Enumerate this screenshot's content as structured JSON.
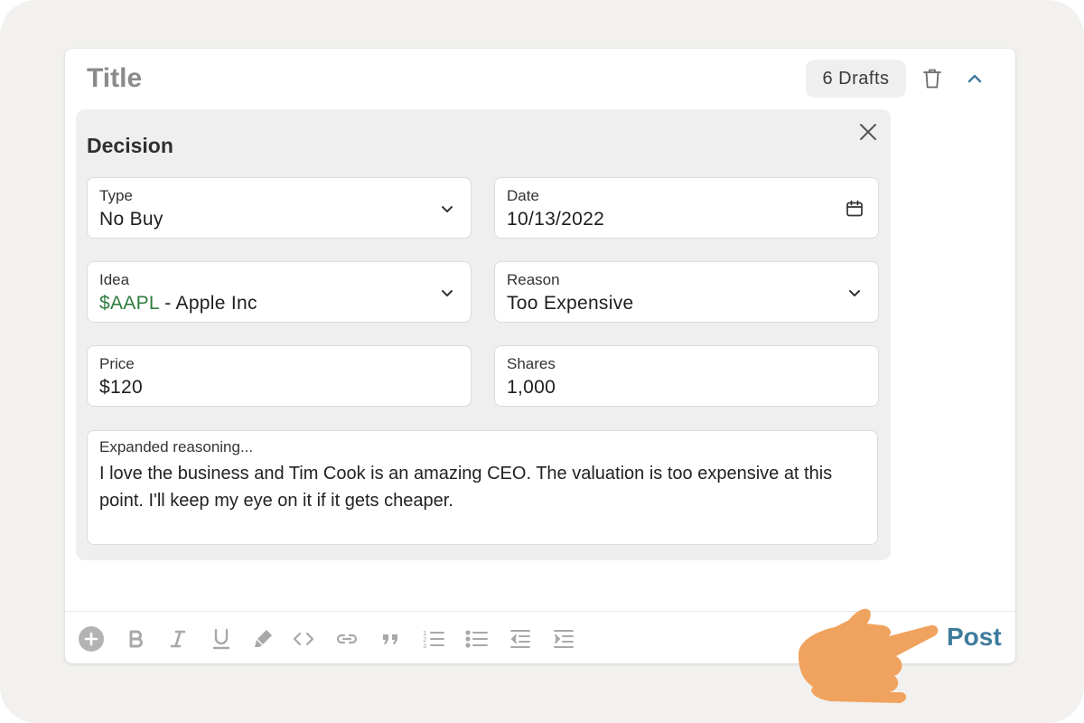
{
  "header": {
    "title": "Title",
    "drafts_label": "6 Drafts"
  },
  "decision": {
    "heading": "Decision",
    "type": {
      "label": "Type",
      "value": "No Buy"
    },
    "date": {
      "label": "Date",
      "value": "10/13/2022"
    },
    "idea": {
      "label": "Idea",
      "ticker": "$AAPL",
      "company": " - Apple Inc"
    },
    "reason": {
      "label": "Reason",
      "value": "Too Expensive"
    },
    "price": {
      "label": "Price",
      "value": "$120"
    },
    "shares": {
      "label": "Shares",
      "value": "1,000"
    },
    "reasoning": {
      "placeholder": "Expanded reasoning...",
      "value": "I love the business and Tim Cook is an amazing CEO. The valuation is too expensive at this point. I'll keep my eye on it if it gets cheaper."
    }
  },
  "toolbar": {
    "post_label": "Post",
    "icons": [
      "add-icon",
      "bold-icon",
      "italic-icon",
      "underline-icon",
      "highlight-icon",
      "code-icon",
      "link-icon",
      "quote-icon",
      "ordered-list-icon",
      "bullet-list-icon",
      "outdent-icon",
      "indent-icon"
    ]
  },
  "colors": {
    "accent": "#3e7c9c",
    "ticker": "#2f7d3e",
    "hand": "#f0a35e"
  }
}
